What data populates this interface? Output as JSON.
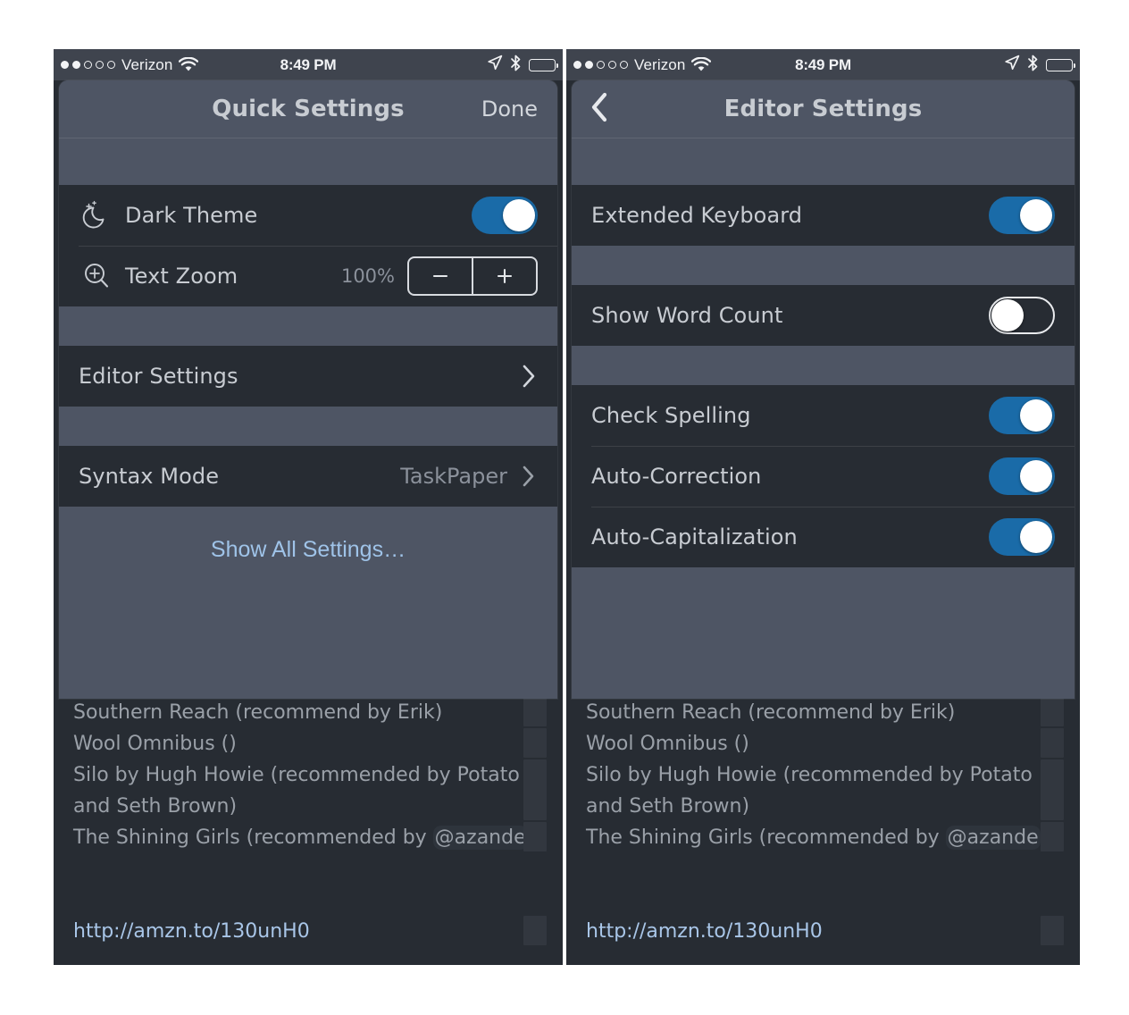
{
  "status_bar": {
    "carrier": "Verizon",
    "signal_dots_filled": 2,
    "signal_dots_total": 5,
    "time": "8:49 PM",
    "wifi_icon": "wifi-icon",
    "location_icon": "location-arrow-icon",
    "bluetooth_icon": "bluetooth-icon",
    "battery_icon": "battery-full-icon"
  },
  "left_panel": {
    "navbar": {
      "title": "Quick Settings",
      "done_label": "Done"
    },
    "rows": {
      "dark_theme": {
        "label": "Dark Theme",
        "icon": "moon-stars-icon",
        "toggle_state": "on"
      },
      "text_zoom": {
        "label": "Text Zoom",
        "icon": "magnifier-plus-icon",
        "value": "100%",
        "decrease_label": "−",
        "increase_label": "+"
      },
      "editor_settings": {
        "label": "Editor Settings",
        "chevron": "chevron-right-icon"
      },
      "syntax_mode": {
        "label": "Syntax Mode",
        "value": "TaskPaper",
        "chevron": "chevron-right-icon"
      }
    },
    "show_all": "Show All Settings…"
  },
  "right_panel": {
    "navbar": {
      "title": "Editor Settings",
      "back_icon": "chevron-left-icon"
    },
    "rows": {
      "extended_keyboard": {
        "label": "Extended Keyboard",
        "toggle_state": "on"
      },
      "show_word_count": {
        "label": "Show Word Count",
        "toggle_state": "off"
      },
      "check_spelling": {
        "label": "Check Spelling",
        "toggle_state": "on"
      },
      "auto_correction": {
        "label": "Auto-Correction",
        "toggle_state": "on"
      },
      "auto_capitalization": {
        "label": "Auto-Capitalization",
        "toggle_state": "on"
      }
    }
  },
  "document": {
    "lines": [
      "Southern Reach (recommend by Erik)",
      "Wool Omnibus ()",
      "Silo by Hugh Howie (recommended by Potato",
      "and Seth Brown)"
    ],
    "tagged_line_prefix": "The Shining Girls (recommended by ",
    "tagged_line_tag": "@azande",
    "tagged_line_suffix": ")",
    "url": "http://amzn.to/130unH0"
  },
  "colors": {
    "page_background": "#ffffff",
    "status_bar": "#3f444e",
    "sheet_background": "#4e5564",
    "row_background": "#272c33",
    "toggle_on": "#1a6ba8",
    "label_text": "#c8ccd2",
    "muted_text": "#8b919b",
    "link_blue": "#9fc3e8",
    "doc_text": "#9aa0a8"
  }
}
